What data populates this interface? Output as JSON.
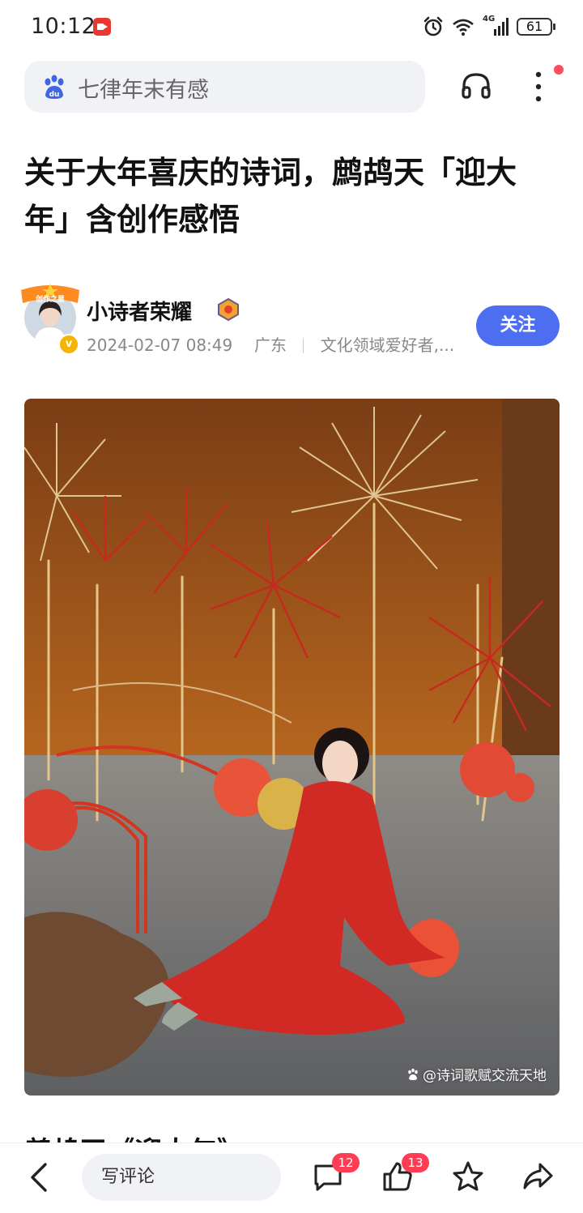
{
  "status_bar": {
    "time": "10:12",
    "network_label": "4G",
    "battery_level": "61"
  },
  "search": {
    "query": "七律年末有感",
    "logo_text": "du"
  },
  "article": {
    "title": "关于大年喜庆的诗词，鹧鸪天「迎大年」含创作感悟",
    "next_heading": "鹧鸪天《迎大年》"
  },
  "author": {
    "name": "小诗者荣耀",
    "badge_text": "创作之星",
    "verified_mark": "v",
    "date": "2024-02-07 08:49",
    "location": "广东",
    "bio": "文化领域爱好者,..."
  },
  "follow_label": "关注",
  "image": {
    "watermark": "@诗词歌赋交流天地"
  },
  "bottom_bar": {
    "comment_placeholder": "写评论",
    "comment_count": "12",
    "like_count": "13"
  },
  "colors": {
    "accent": "#4e6ef2",
    "badge_red": "#ff3d54",
    "notification_dot": "#ff4d5f"
  }
}
